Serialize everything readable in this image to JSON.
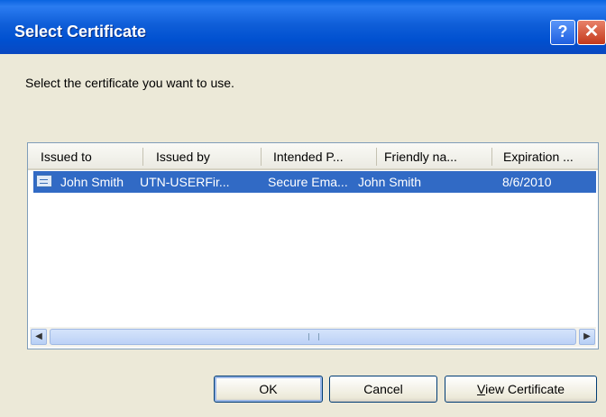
{
  "window": {
    "title": "Select Certificate",
    "help_icon": "?",
    "close_icon": "✕"
  },
  "prompt": "Select the certificate you want to use.",
  "listview": {
    "columns": [
      "Issued to",
      "Issued by",
      "Intended P...",
      "Friendly na...",
      "Expiration ..."
    ],
    "rows": [
      {
        "issued_to": "John Smith",
        "issued_by": "UTN-USERFir...",
        "intended_purposes": "Secure Ema...",
        "friendly_name": "John Smith",
        "expiration": "8/6/2010"
      }
    ],
    "scroll_left_icon": "◀",
    "scroll_right_icon": "▶"
  },
  "buttons": {
    "ok": "OK",
    "cancel": "Cancel",
    "view_first": "V",
    "view_rest": "iew Certificate"
  },
  "colors": {
    "selection": "#316ac5",
    "title_bar": "#0050d0"
  }
}
